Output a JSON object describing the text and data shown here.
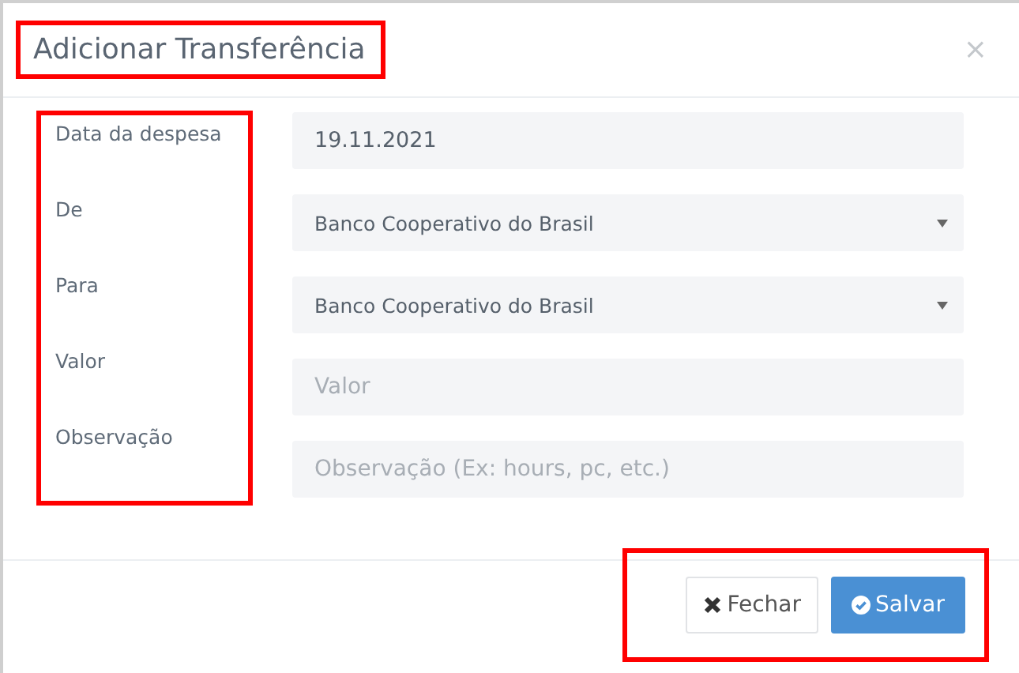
{
  "dialog": {
    "title": "Adicionar Transferência",
    "title_highlighted": true,
    "close": "×"
  },
  "form": {
    "labels_highlighted": true,
    "fields": [
      {
        "label": "Data da despesa",
        "kind": "text",
        "value": "19.11.2021"
      },
      {
        "label": "De",
        "kind": "select",
        "value": "Banco Cooperativo do Brasil"
      },
      {
        "label": "Para",
        "kind": "select",
        "value": "Banco Cooperativo do Brasil"
      },
      {
        "label": "Valor",
        "kind": "text",
        "placeholder": "Valor"
      },
      {
        "label": "Observação",
        "kind": "text",
        "placeholder": "Observação (Ex: hours, pc, etc.)"
      }
    ]
  },
  "footer": {
    "highlighted": true,
    "buttons": [
      {
        "kind": "close",
        "label": "Fechar"
      },
      {
        "kind": "save",
        "label": "Salvar"
      }
    ]
  }
}
